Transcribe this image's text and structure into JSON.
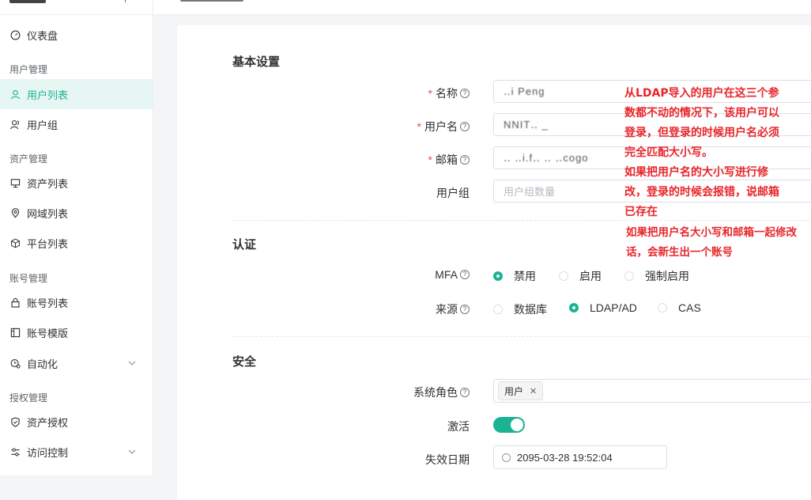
{
  "sidebar": {
    "items": [
      {
        "label": "仪表盘"
      },
      {
        "label": "用户列表"
      },
      {
        "label": "用户组"
      },
      {
        "label": "资产列表"
      },
      {
        "label": "网域列表"
      },
      {
        "label": "平台列表"
      },
      {
        "label": "账号列表"
      },
      {
        "label": "账号模版"
      },
      {
        "label": "自动化"
      },
      {
        "label": "资产授权"
      },
      {
        "label": "访问控制"
      }
    ],
    "groups": {
      "user": "用户管理",
      "asset": "资产管理",
      "account": "账号管理",
      "perm": "授权管理"
    }
  },
  "form": {
    "basic_title": "基本设置",
    "name_label": "名称",
    "name_value": "‥i Peng",
    "username_label": "用户名",
    "username_value": "NNIT‥ _",
    "email_label": "邮箱",
    "email_value": "‥ ‥i.f‥ ‥ ‥cogo",
    "group_label": "用户组",
    "group_placeholder": "用户组数量",
    "auth_title": "认证",
    "mfa_label": "MFA",
    "mfa_options": [
      "禁用",
      "启用",
      "强制启用"
    ],
    "source_label": "来源",
    "source_options": [
      "数据库",
      "LDAP/AD",
      "CAS"
    ],
    "security_title": "安全",
    "role_label": "系统角色",
    "role_tag": "用户",
    "active_label": "激活",
    "expire_label": "失效日期",
    "expire_value": "2095-03-28 19:52:04"
  },
  "annotation": {
    "lines1": [
      "从LDAP导入的用户在这三个参",
      "数都不动的情况下，该用户可以",
      "登录，但登录的时候用户名必须",
      "完全匹配大小写。",
      "如果把用户名的大小写进行修",
      "改，登录的时候会报错，说邮箱",
      "已存在"
    ],
    "lines2": [
      "如果把用户名大小写和邮箱一起修改",
      "话，会新生出一个账号"
    ]
  },
  "colors": {
    "accent": "#1ab394",
    "annotation": "#e8262b"
  }
}
